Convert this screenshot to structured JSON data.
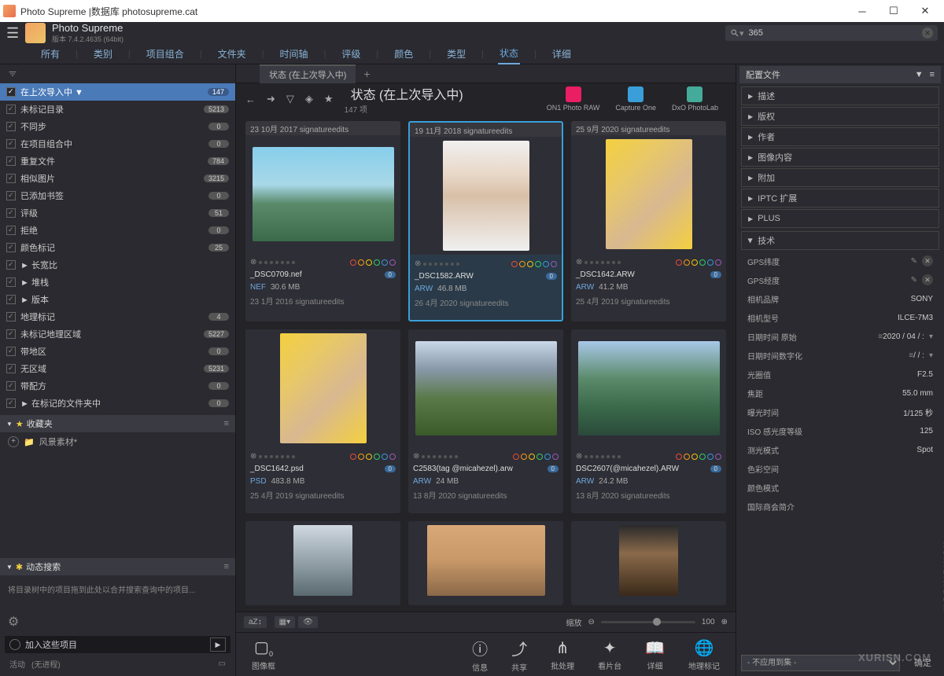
{
  "window": {
    "title": "Photo Supreme |数据库 photosupreme.cat"
  },
  "app": {
    "name": "Photo Supreme",
    "version": "版本 7.4.2.4635 (64bit)"
  },
  "search": {
    "value": "365"
  },
  "nav": [
    "所有",
    "类别",
    "项目组合",
    "文件夹",
    "时间轴",
    "评级",
    "颜色",
    "类型",
    "状态",
    "详细"
  ],
  "navActive": "状态",
  "side": [
    {
      "label": "在上次导入中 ▼",
      "badge": "147",
      "sel": true
    },
    {
      "label": "未标记目录",
      "badge": "5213"
    },
    {
      "label": "不同步",
      "badge": "0"
    },
    {
      "label": "在项目组合中",
      "badge": "0"
    },
    {
      "label": "重复文件",
      "badge": "784"
    },
    {
      "label": "相似图片",
      "badge": "3215"
    },
    {
      "label": "已添加书签",
      "badge": "0"
    },
    {
      "label": "评级",
      "badge": "51"
    },
    {
      "label": "拒绝",
      "badge": "0"
    },
    {
      "label": "颜色标记",
      "badge": "25"
    },
    {
      "label": "► 长宽比",
      "badge": ""
    },
    {
      "label": "► 堆栈",
      "badge": ""
    },
    {
      "label": "► 版本",
      "badge": ""
    },
    {
      "label": "地理标记",
      "badge": "4"
    },
    {
      "label": "未标记地理区域",
      "badge": "5227"
    },
    {
      "label": "带地区",
      "badge": "0"
    },
    {
      "label": "无区域",
      "badge": "5231"
    },
    {
      "label": "带配方",
      "badge": "0"
    },
    {
      "label": "► 在标记的文件夹中",
      "badge": "0"
    }
  ],
  "fav": {
    "header": "收藏夹",
    "item": "风景素材*"
  },
  "dyn": {
    "header": "动态搜索",
    "hint": "将目录树中的项目拖到此处以合并搜索查询中的项目..."
  },
  "addItems": "加入这些项目",
  "activity": {
    "label": "活动",
    "status": "(无进程)"
  },
  "ctab": "状态 (在上次导入中)",
  "page": {
    "title": "状态 (在上次导入中)",
    "sub": "147 项"
  },
  "ext": [
    {
      "name": "ON1 Photo RAW",
      "color": "#e91e63"
    },
    {
      "name": "Capture One",
      "color": "#3a9fd8"
    },
    {
      "name": "DxO PhotoLab",
      "color": "#4a9"
    }
  ],
  "configFiles": "配置文件",
  "thumbs": [
    {
      "hdr": "23 10月 2017  signatureedits",
      "name": "_DSC0709.nef",
      "ext": "NEF",
      "size": "30.6 MB",
      "date": "23 1月 2016  signatureedits",
      "land": true,
      "bg": "linear-gradient(180deg,#87ceeb 0%,#a8d8e8 40%,#5a8a6a 60%,#3a6a4a 100%)"
    },
    {
      "hdr": "19 11月 2018  signatureedits",
      "name": "_DSC1582.ARW",
      "ext": "ARW",
      "size": "46.8 MB",
      "date": "26 4月 2020  signatureedits",
      "sel": true,
      "bg": "linear-gradient(180deg,#f0f0f0 0%,#e8d8c8 30%,#d8c0a8 50%,#f0f0f0 100%)"
    },
    {
      "hdr": "25 9月 2020  signatureedits",
      "name": "_DSC1642.ARW",
      "ext": "ARW",
      "size": "41.2 MB",
      "date": "25 4月 2019  signatureedits",
      "bg": "linear-gradient(135deg,#f4d03f 0%,#e8c868 30%,#d8b890 60%,#f4d03f 100%)"
    },
    {
      "hdr": "",
      "name": "_DSC1642.psd",
      "ext": "PSD",
      "size": "483.8 MB",
      "date": "25 4月 2019  signatureedits",
      "bg": "linear-gradient(135deg,#f4d03f 0%,#e8c868 30%,#d8b890 60%,#f4d03f 100%)"
    },
    {
      "hdr": "",
      "name": "C2583(tag @micahezel).arw",
      "ext": "ARW",
      "size": "24 MB",
      "date": "13 8月 2020  signatureedits",
      "land": true,
      "bg": "linear-gradient(180deg,#c8d8e8 0%,#8898a8 30%,#5a7a4a 60%,#3a5a2a 100%)"
    },
    {
      "hdr": "",
      "name": "DSC2607(@micahezel).ARW",
      "ext": "ARW",
      "size": "24.2 MB",
      "date": "13 8月 2020  signatureedits",
      "land": true,
      "bg": "linear-gradient(180deg,#a8c8e8 0%,#5a8a6a 40%,#3a6a4a 70%,#2a4a3a 100%)"
    }
  ],
  "shortthumbs": [
    {
      "bg": "linear-gradient(180deg,#d0d8e0 0%,#8a98a0 60%,#5a6a70 100%)"
    },
    {
      "land": true,
      "bg": "linear-gradient(180deg,#d8a878 0%,#c89868 50%,#8a6848 100%)"
    },
    {
      "bg": "linear-gradient(180deg,#2a2a2a 0%,#8a6a4a 40%,#3a2a1a 100%)"
    }
  ],
  "zoom": {
    "label": "缩放",
    "val": "100"
  },
  "iconbar": [
    {
      "i": "▢",
      "l": "图像框",
      "n": "0"
    },
    {
      "i": "ⓘ",
      "l": "信息"
    },
    {
      "i": "⤴",
      "l": "共享"
    },
    {
      "i": "⋔",
      "l": "批处理"
    },
    {
      "i": "✦",
      "l": "看片台"
    },
    {
      "i": "📖",
      "l": "详细"
    },
    {
      "i": "🌐",
      "l": "地理标记"
    }
  ],
  "rsecs": [
    "描述",
    "版权",
    "作者",
    "图像内容",
    "附加",
    "IPTC 扩展",
    "PLUS"
  ],
  "tech": {
    "header": "技术",
    "fields": [
      {
        "lbl": "GPS纬度",
        "val": "",
        "e": true,
        "d": true
      },
      {
        "lbl": "GPS经度",
        "val": "",
        "e": true,
        "d": true
      },
      {
        "lbl": "相机品牌",
        "val": "SONY"
      },
      {
        "lbl": "相机型号",
        "val": "ILCE-7M3"
      },
      {
        "lbl": "日期时间 原始",
        "val": "2020 / 04 / :",
        "m": true
      },
      {
        "lbl": "日期时间数字化",
        "val": "/    /  :",
        "m": true
      },
      {
        "lbl": "光圈值",
        "val": "F2.5"
      },
      {
        "lbl": "焦距",
        "val": "55.0 mm"
      },
      {
        "lbl": "曝光时间",
        "val": "1/125 秒"
      },
      {
        "lbl": "ISO 感光度等级",
        "val": "125"
      },
      {
        "lbl": "测光模式",
        "val": "Spot"
      },
      {
        "lbl": "色彩空间",
        "val": ""
      },
      {
        "lbl": "颜色模式",
        "val": ""
      },
      {
        "lbl": "国际商会简介",
        "val": ""
      }
    ]
  },
  "apply": {
    "sel": "- 不应用到集 -",
    "ok": "确定"
  }
}
